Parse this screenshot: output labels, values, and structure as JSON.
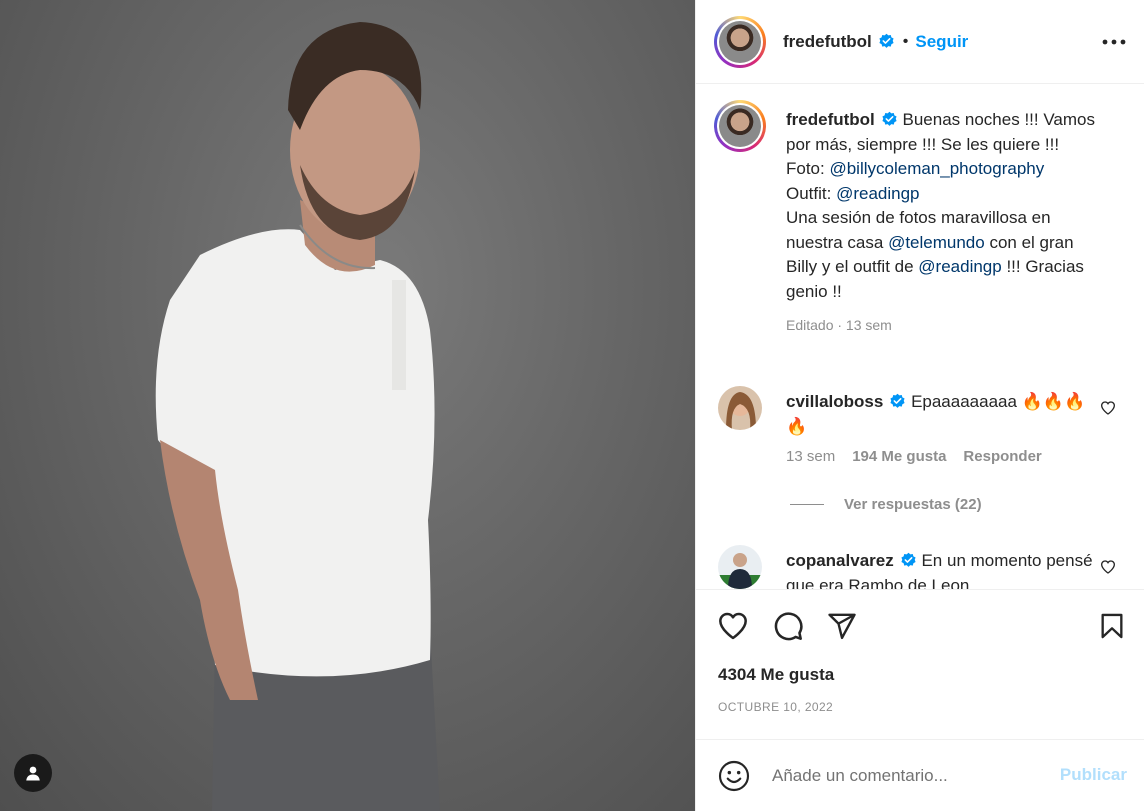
{
  "post": {
    "username": "fredefutbol",
    "follow_label": "Seguir",
    "separator": "•",
    "caption": {
      "text_1": "Buenas noches !!! Vamos por más, siempre !!! Se les quiere !!!",
      "foto_label": "Foto: ",
      "foto_mention": "@billycoleman_photography",
      "outfit_label": "Outfit: ",
      "outfit_mention": "@readingp",
      "text_2": "Una sesión de fotos maravillosa en nuestra casa ",
      "mention_3": "@telemundo",
      "text_3": " con el gran Billy y el outfit de ",
      "mention_4": "@readingp",
      "text_4": " !!! Gracias genio !!",
      "meta": "Editado · 13 sem"
    },
    "likes": "4304 Me gusta",
    "date": "OCTUBRE 10, 2022"
  },
  "comments": [
    {
      "username": "cvillaloboss",
      "text": "Epaaaaaaaaa 🔥🔥🔥🔥",
      "time": "13 sem",
      "likes": "194 Me gusta",
      "reply_label": "Responder"
    },
    {
      "username": "copanalvarez",
      "text": "En un momento pensé que era Rambo de Leon"
    }
  ],
  "view_replies": "Ver respuestas (22)",
  "add_comment": {
    "placeholder": "Añade un comentario...",
    "publish_label": "Publicar"
  },
  "colors": {
    "accent": "#0095f6",
    "mention": "#00376b",
    "muted": "#8e8e8e",
    "publish_disabled": "#b2dffc"
  },
  "icons": [
    "user-tag-icon",
    "verified-badge-icon",
    "more-options-icon",
    "heart-icon",
    "comment-icon",
    "share-icon",
    "bookmark-icon",
    "emoji-icon"
  ]
}
